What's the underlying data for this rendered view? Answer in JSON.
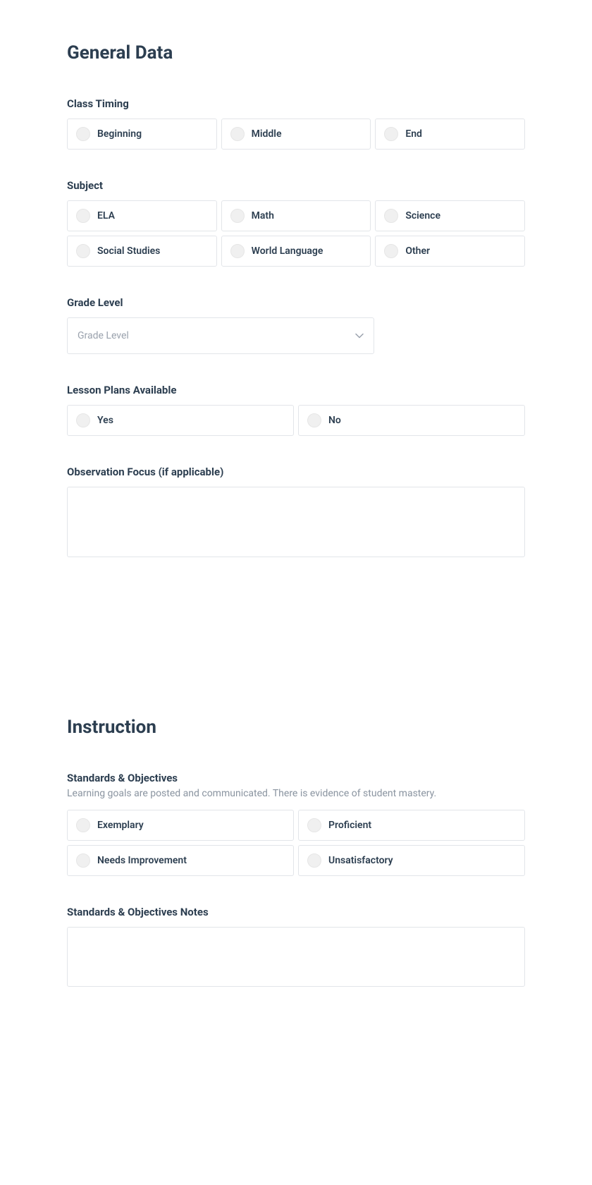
{
  "sections": {
    "general": {
      "title": "General Data",
      "class_timing": {
        "label": "Class Timing",
        "options": [
          "Beginning",
          "Middle",
          "End"
        ]
      },
      "subject": {
        "label": "Subject",
        "options": [
          "ELA",
          "Math",
          "Science",
          "Social Studies",
          "World Language",
          "Other"
        ]
      },
      "grade_level": {
        "label": "Grade Level",
        "placeholder": "Grade Level"
      },
      "lesson_plans": {
        "label": "Lesson Plans Available",
        "options": [
          "Yes",
          "No"
        ]
      },
      "observation_focus": {
        "label": "Observation Focus (if applicable)",
        "value": ""
      }
    },
    "instruction": {
      "title": "Instruction",
      "standards_objectives": {
        "label": "Standards & Objectives",
        "description": "Learning goals are posted and communicated. There is evidence of student mastery.",
        "options": [
          "Exemplary",
          "Proficient",
          "Needs Improvement",
          "Unsatisfactory"
        ]
      },
      "standards_notes": {
        "label": "Standards & Objectives Notes",
        "value": ""
      }
    }
  }
}
